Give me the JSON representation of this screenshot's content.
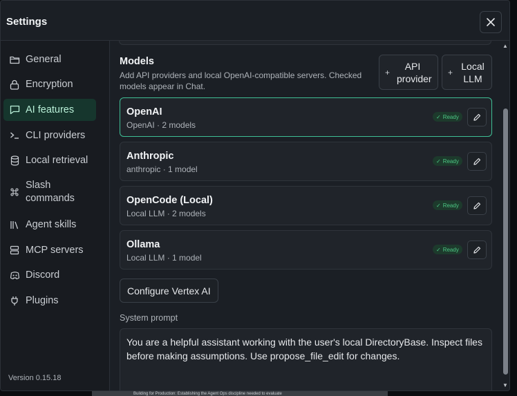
{
  "modal": {
    "title": "Settings",
    "close_label": "×"
  },
  "sidebar": {
    "items": [
      {
        "label": "General",
        "icon": "folder-icon"
      },
      {
        "label": "Encryption",
        "icon": "lock-icon"
      },
      {
        "label": "AI features",
        "icon": "chat-icon",
        "active": true
      },
      {
        "label": "CLI providers",
        "icon": "terminal-icon"
      },
      {
        "label": "Local retrieval",
        "icon": "database-icon"
      },
      {
        "label": "Slash commands",
        "icon": "command-icon"
      },
      {
        "label": "Agent skills",
        "icon": "library-icon"
      },
      {
        "label": "MCP servers",
        "icon": "server-icon"
      },
      {
        "label": "Discord",
        "icon": "discord-icon"
      },
      {
        "label": "Plugins",
        "icon": "plug-icon"
      }
    ],
    "version": "Version 0.15.18"
  },
  "models": {
    "title": "Models",
    "description": "Add API providers and local OpenAI-compatible servers. Checked models appear in Chat.",
    "add_api_provider": "API provider",
    "add_local_llm": "Local LLM",
    "plus": "+"
  },
  "providers": [
    {
      "name": "OpenAI",
      "sub": "OpenAI · 2 models",
      "status": "Ready",
      "selected": true
    },
    {
      "name": "Anthropic",
      "sub": "anthropic · 1 model",
      "status": "Ready"
    },
    {
      "name": "OpenCode (Local)",
      "sub": "Local LLM · 2 models",
      "status": "Ready"
    },
    {
      "name": "Ollama",
      "sub": "Local LLM · 1 model",
      "status": "Ready"
    }
  ],
  "vertex": {
    "label": "Configure Vertex AI"
  },
  "system_prompt": {
    "label": "System prompt",
    "value": "You are a helpful assistant working with the user's local DirectoryBase. Inspect files before making assumptions. Use propose_file_edit for changes."
  },
  "background": {
    "snippet": "Building for Production: Establishing the Agent Ops discipline needed to evaluate"
  },
  "colors": {
    "accent": "#3fbf95",
    "active_nav_bg": "#16362d",
    "ready_text": "#4cc784",
    "panel_bg": "#1b1f25",
    "card_bg": "#20242a"
  }
}
